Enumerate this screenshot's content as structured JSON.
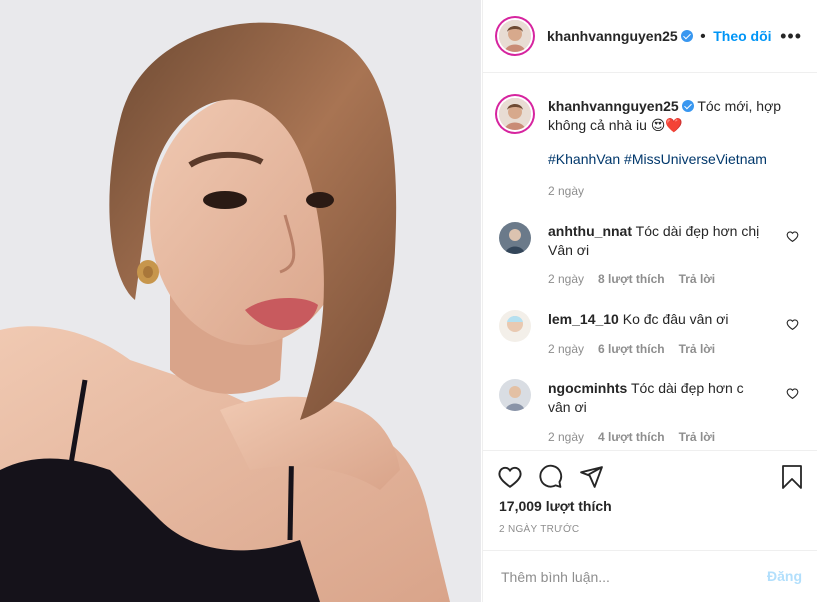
{
  "post": {
    "author": "khanhvannguyen25",
    "follow_label": "Theo dõi",
    "more_label": "•••",
    "caption_text": "Tóc mới, hợp không cả nhà iu",
    "caption_emoji": "😍❤️",
    "hashtags": "#KhanhVan #MissUniverseVietnam",
    "caption_time": "2 ngày"
  },
  "comments": [
    {
      "user": "anhthu_nnat",
      "text": "Tóc dài đẹp hơn chị Vân ơi",
      "time": "2 ngày",
      "likes": "8 lượt thích",
      "reply": "Trả lời"
    },
    {
      "user": "lem_14_10",
      "text": "Ko đc đâu vân ơi",
      "time": "2 ngày",
      "likes": "6 lượt thích",
      "reply": "Trả lời"
    },
    {
      "user": "ngocminhts",
      "text": "Tóc dài đẹp hơn c vân ơi",
      "time": "2 ngày",
      "likes": "4 lượt thích",
      "reply": "Trả lời"
    }
  ],
  "stats": {
    "likes": "17,009 lượt thích",
    "date": "2 NGÀY TRƯỚC"
  },
  "composer": {
    "placeholder": "Thêm bình luận...",
    "post_label": "Đăng"
  },
  "colors": {
    "accent": "#0095f6",
    "hashtag": "#00376b",
    "muted": "#8e8e8e",
    "post_disabled": "#b2dffc"
  }
}
